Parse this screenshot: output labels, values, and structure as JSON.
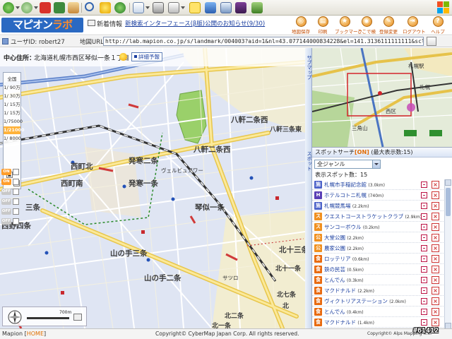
{
  "header": {
    "logo_main": "マピオン",
    "logo_accent": "ラボ",
    "news_label": "新着情報",
    "news_link": "新検索インターフェース(β版)公開のお知らせ(9/30)",
    "nav": [
      {
        "label": "地図保存",
        "icon": "save-icon"
      },
      {
        "label": "印刷",
        "icon": "print-icon"
      },
      {
        "label": "ブックマーク",
        "icon": "bookmark-icon"
      },
      {
        "label": "ここで検",
        "icon": "search-here-icon"
      },
      {
        "label": "登録変更",
        "icon": "settings-icon"
      },
      {
        "label": "ログアウト",
        "icon": "logout-icon"
      },
      {
        "label": "ヘルプ",
        "icon": "help-icon"
      }
    ]
  },
  "urlbar": {
    "user_label": "ユーザID: robert27",
    "url_label": "地図URL",
    "url_value": "http://lab.mapion.co.jp/s/landmark/004003?aid=1&nl=43.077144000834228&el=141.3136111111111&scl=66&sf=0&opt=0&lv=3"
  },
  "map": {
    "location_label": "中心住所：",
    "location_value": "北海道札幌市西区琴似一条１丁目",
    "details_label": "詳細予報",
    "scales": [
      "全国",
      "1/ 90万",
      "1/ 30万",
      "1/ 15万",
      "1/ 15万",
      "1/75000",
      "1/21000",
      "1/ 8000"
    ],
    "active_scale_index": 6,
    "labels": {
      "hachiken_nijo_nishi": "八軒二条西",
      "hachiken_sanjo_higashi": "八軒三条東",
      "hachiken_nijo_nishi2": "八軒二条西",
      "hassamu_nijo": "発寒二条",
      "hassamu_ichijo": "発寒一条",
      "nishimachi_kita": "西町北",
      "nishimachi_minami": "西町南",
      "kotoni_ichijo": "琴似一条",
      "nishino_shijo": "西野四条",
      "sanjo": "三条",
      "yamanote_sanjo": "山の手三条",
      "yamanote_nijo": "山の手二条",
      "kita_jusanjo": "北十三条",
      "kita_juichijo": "北十一条",
      "kita_nanajo": "北七条",
      "kita": "北",
      "kita_nijo": "北二条",
      "kita_ichijo": "北一条",
      "satsuro": "サツロ",
      "vuelta": "ヴェルビュアワー"
    },
    "scale_bar_label": "700m",
    "tools": [
      "ON",
      "OFF",
      "OFF",
      "OFF",
      "OFF"
    ]
  },
  "overview": {
    "tab_label": "サブマップ",
    "labels": {
      "sapporo": "札幌",
      "sapporo_eki": "札幌駅",
      "nishi": "西区",
      "sankaku": "三角山"
    }
  },
  "spot": {
    "tab_label": "スポット",
    "header_title": "スポットサーチ",
    "header_on": "[ON]",
    "header_max": "(最大表示数:15)",
    "genre": "全ジャンル",
    "count_label": "表示スポット数：15",
    "items": [
      {
        "name": "札幌市手稲記念館",
        "dist": "(3.0km)",
        "color": "#4d63c9",
        "glyph": "施"
      },
      {
        "name": "ホテルコトニ札幌",
        "dist": "(740m)",
        "color": "#5a3fb6",
        "glyph": "H"
      },
      {
        "name": "札幌競馬場",
        "dist": "(2.2km)",
        "color": "#4d63c9",
        "glyph": "施"
      },
      {
        "name": "ウエストコーストラケットクラブ",
        "dist": "(2.9km)",
        "color": "#f09020",
        "glyph": "ス"
      },
      {
        "name": "サンコーボウル",
        "dist": "(0.2km)",
        "color": "#f09020",
        "glyph": "ス"
      },
      {
        "name": "大堂公園",
        "dist": "(2.2km)",
        "color": "#f09020",
        "glyph": "公"
      },
      {
        "name": "農家公園",
        "dist": "(2.2km)",
        "color": "#f09020",
        "glyph": "公"
      },
      {
        "name": "ロッテリア",
        "dist": "(0.6km)",
        "color": "#e86a10",
        "glyph": "食"
      },
      {
        "name": "鉄の民芸",
        "dist": "(0.5km)",
        "color": "#e86a10",
        "glyph": "食"
      },
      {
        "name": "とんでん",
        "dist": "(0.3km)",
        "color": "#e86a10",
        "glyph": "食"
      },
      {
        "name": "マクドナルド",
        "dist": "(2.2km)",
        "color": "#e86a10",
        "glyph": "食"
      },
      {
        "name": "ヴィクトリアステーション",
        "dist": "(2.0km)",
        "color": "#e86a10",
        "glyph": "食"
      },
      {
        "name": "とんでん",
        "dist": "(0.4km)",
        "color": "#e86a10",
        "glyph": "食"
      },
      {
        "name": "マクドナルド",
        "dist": "(1.4km)",
        "color": "#e86a10",
        "glyph": "食"
      }
    ]
  },
  "footer": {
    "brand": "Mapion [",
    "home": "HOME",
    "brand_end": "]",
    "copyright": "Copyright© CyberMap Japan Corp. All rights reserved.",
    "alps": "Copyright© Alps Mapping K.K."
  },
  "watermark": "#61412",
  "colors": {
    "accent": "#ff8c2a",
    "brand_blue": "#2a69c2",
    "link": "#1b3fa0"
  }
}
